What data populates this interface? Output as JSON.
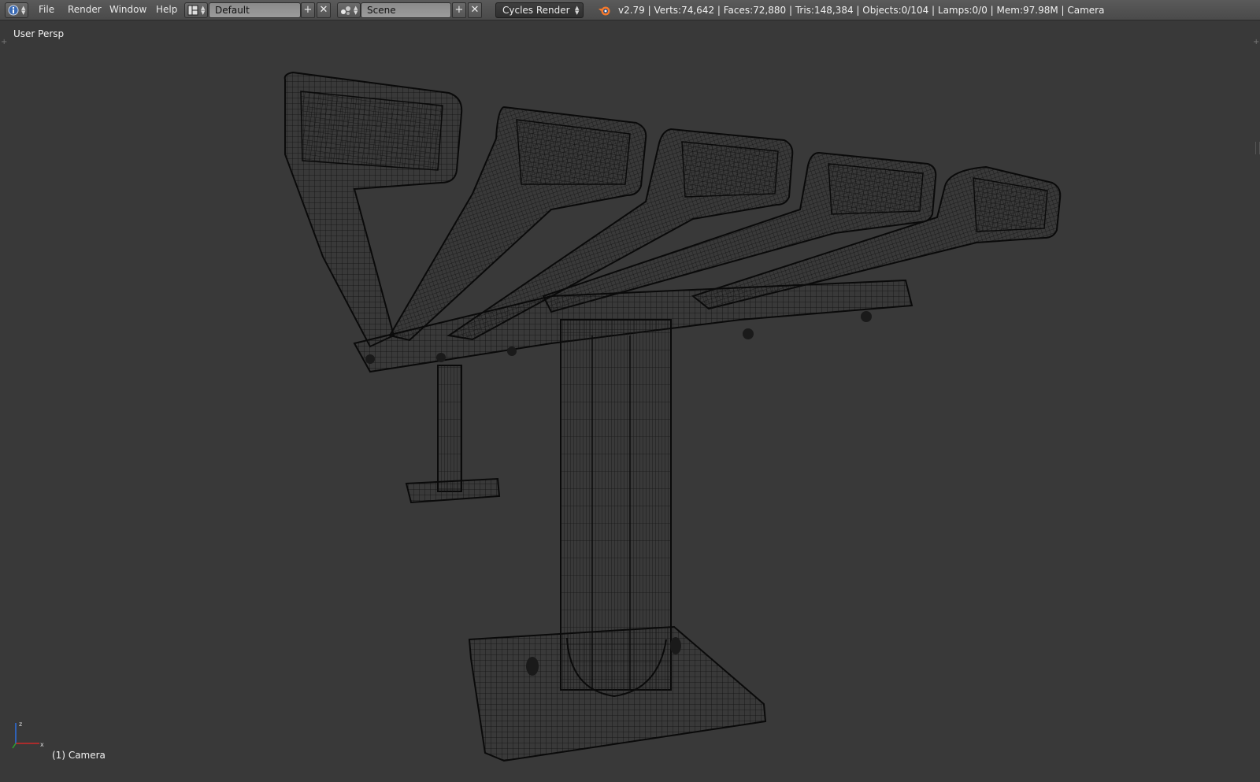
{
  "header": {
    "editor_type_icon": "info-icon",
    "menus": [
      "File",
      "Render",
      "Window",
      "Help"
    ],
    "screen_layout_icon": "screen-layout-icon",
    "screen_layout": "Default",
    "scene_icon": "scene-icon",
    "scene": "Scene",
    "render_engine": "Cycles Render",
    "blender_icon": "blender-logo-icon",
    "stats": "v2.79 | Verts:74,642 | Faces:72,880 | Tris:148,384 | Objects:0/104 | Lamps:0/0 | Mem:97.98M | Camera"
  },
  "viewport": {
    "view_label": "User Persp",
    "object_label": "(1) Camera",
    "axis_labels": {
      "z": "z",
      "x": "x"
    },
    "shading": "wireframe",
    "colors": {
      "background": "#393939",
      "wire": "#000000",
      "header": "#4f4f4f"
    }
  }
}
